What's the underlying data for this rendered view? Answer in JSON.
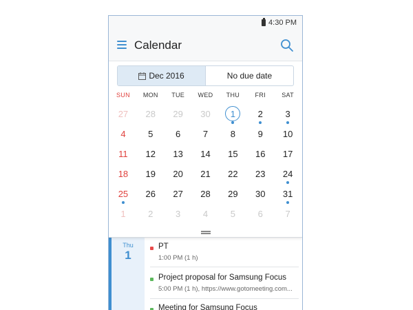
{
  "status": {
    "time": "4:30 PM"
  },
  "header": {
    "title": "Calendar"
  },
  "segment": {
    "left_label": "Dec 2016",
    "right_label": "No due date"
  },
  "weekdays": [
    "SUN",
    "MON",
    "TUE",
    "WED",
    "THU",
    "FRI",
    "SAT"
  ],
  "weeks": [
    [
      {
        "d": "27",
        "out": true
      },
      {
        "d": "28",
        "out": true
      },
      {
        "d": "29",
        "out": true
      },
      {
        "d": "30",
        "out": true
      },
      {
        "d": "1",
        "today": true,
        "dot": "#3f8fd0"
      },
      {
        "d": "2",
        "dot": "#3f8fd0"
      },
      {
        "d": "3",
        "dot": "#3f8fd0"
      }
    ],
    [
      {
        "d": "4"
      },
      {
        "d": "5"
      },
      {
        "d": "6"
      },
      {
        "d": "7"
      },
      {
        "d": "8"
      },
      {
        "d": "9"
      },
      {
        "d": "10"
      }
    ],
    [
      {
        "d": "11"
      },
      {
        "d": "12"
      },
      {
        "d": "13"
      },
      {
        "d": "14"
      },
      {
        "d": "15"
      },
      {
        "d": "16"
      },
      {
        "d": "17"
      }
    ],
    [
      {
        "d": "18"
      },
      {
        "d": "19"
      },
      {
        "d": "20"
      },
      {
        "d": "21"
      },
      {
        "d": "22"
      },
      {
        "d": "23"
      },
      {
        "d": "24",
        "dot": "#3f8fd0"
      }
    ],
    [
      {
        "d": "25",
        "dot": "#3f8fd0"
      },
      {
        "d": "26"
      },
      {
        "d": "27"
      },
      {
        "d": "28"
      },
      {
        "d": "29"
      },
      {
        "d": "30"
      },
      {
        "d": "31",
        "dot": "#3f8fd0"
      }
    ],
    [
      {
        "d": "1",
        "out": true
      },
      {
        "d": "2",
        "out": true
      },
      {
        "d": "3",
        "out": true
      },
      {
        "d": "4",
        "out": true
      },
      {
        "d": "5",
        "out": true
      },
      {
        "d": "6",
        "out": true
      },
      {
        "d": "7",
        "out": true
      }
    ]
  ],
  "agenda": {
    "dow": "Thu",
    "day": "1",
    "events": [
      {
        "title": "PT",
        "sub": "1:00 PM (1 h)",
        "color": "#e84b4b"
      },
      {
        "title": "Project proposal for Samsung Focus",
        "sub": "5:00 PM (1 h), https://www.gotomeeting.com...",
        "color": "#5cb85c"
      },
      {
        "title": "Meeting for Samsung Focus",
        "sub": "",
        "color": "#5cb85c"
      }
    ]
  },
  "colors": {
    "accent": "#3f8fd0",
    "sunday": "#e0413d"
  },
  "icons": {
    "menu": "hamburger-menu-icon",
    "search": "search-icon",
    "calendar": "calendar-icon",
    "battery": "battery-icon",
    "handle": "drag-handle-icon"
  }
}
